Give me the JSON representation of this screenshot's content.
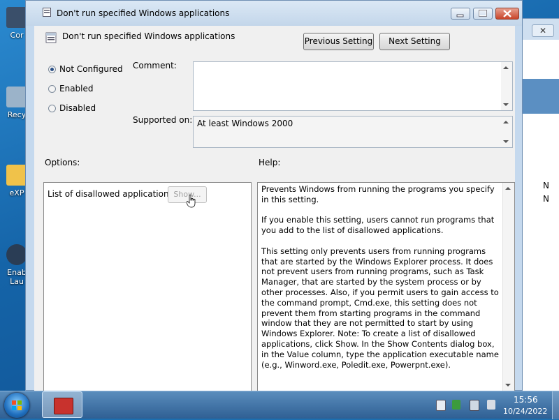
{
  "desktop": {
    "icons": [
      {
        "label": "Cor",
        "color": "#3a4f6a"
      },
      {
        "label": "Recy",
        "color": "#9bb3c9"
      },
      {
        "label": "eXP",
        "color": "#f0c24a"
      },
      {
        "label": "Enab\nLau",
        "color": "#2a3d55"
      }
    ]
  },
  "background_window": {
    "close_glyph": "✕",
    "letters": [
      "N",
      "N"
    ]
  },
  "dialog": {
    "title": "Don't run specified Windows applications",
    "header_title": "Don't run specified Windows applications",
    "previous_setting": "Previous Setting",
    "next_setting": "Next Setting",
    "radio": {
      "not_configured": "Not Configured",
      "enabled": "Enabled",
      "disabled": "Disabled",
      "selected": "not_configured"
    },
    "comment_label": "Comment:",
    "comment_value": "",
    "supported_on_label": "Supported on:",
    "supported_on_value": "At least Windows 2000",
    "options_label": "Options:",
    "help_label": "Help:",
    "options": {
      "list_label": "List of disallowed applications",
      "show_button": "Show..."
    },
    "help_text": "Prevents Windows from running the programs you specify in this setting.\n\nIf you enable this setting, users cannot run programs that you add to the list of disallowed applications.\n\nThis setting only prevents users from running programs that are started by the Windows Explorer process. It does not prevent users from running programs, such as Task Manager, that are started by the system process or by other processes. Also, if you permit users to gain access to the command prompt, Cmd.exe, this setting does not prevent them from starting programs in the command window that they are not permitted to start by using Windows Explorer. Note: To create a list of disallowed applications, click Show. In the Show Contents dialog box, in the Value column, type the application executable name (e.g., Winword.exe, Poledit.exe, Powerpnt.exe)."
  },
  "taskbar": {
    "time": "15:56",
    "date": "10/24/2022",
    "tray_icons": [
      "flag-icon",
      "network-icon",
      "action-center-icon",
      "volume-muted-icon"
    ]
  }
}
